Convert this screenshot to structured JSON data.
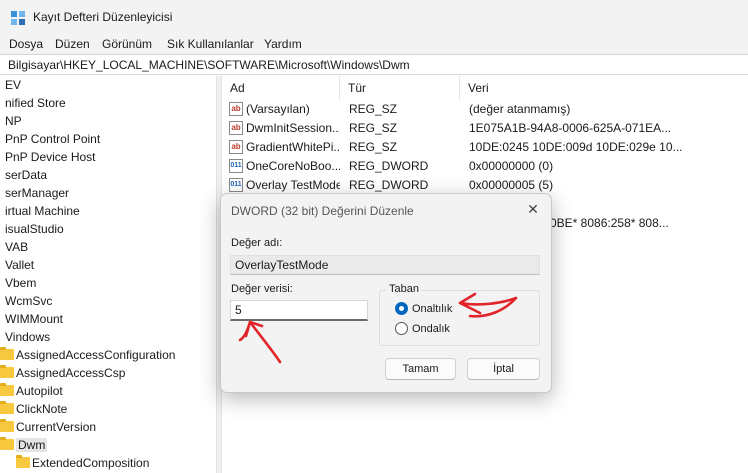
{
  "window": {
    "title": "Kayıt Defteri Düzenleyicisi"
  },
  "menu": [
    "Dosya",
    "Düzen",
    "Görünüm",
    "Sık Kullanılanlar",
    "Yardım"
  ],
  "address": "Bilgisayar\\HKEY_LOCAL_MACHINE\\SOFTWARE\\Microsoft\\Windows\\Dwm",
  "tree": {
    "items": [
      "EV",
      "nified Store",
      "NP",
      "PnP Control Point",
      "PnP Device Host",
      "serData",
      "serManager",
      "irtual Machine",
      "isualStudio",
      "VAB",
      "Vallet",
      "Vbem",
      "WcmSvc",
      "WIMMount",
      "Vindows"
    ],
    "subitems": [
      "AssignedAccessConfiguration",
      "AssignedAccessCsp",
      "Autopilot",
      "ClickNote",
      "CurrentVersion",
      "Dwm",
      "ExtendedComposition"
    ],
    "selected": "Dwm"
  },
  "list": {
    "columns": [
      "Ad",
      "Tür",
      "Veri"
    ],
    "rows": [
      {
        "icon": "string-value-icon",
        "name": "(Varsayılan)",
        "type": "REG_SZ",
        "data": "(değer atanmamış)"
      },
      {
        "icon": "string-value-icon",
        "name": "DwmInitSession...",
        "type": "REG_SZ",
        "data": "1E075A1B-94A8-0006-625A-071EA..."
      },
      {
        "icon": "string-value-icon",
        "name": "GradientWhitePi...",
        "type": "REG_SZ",
        "data": "10DE:0245 10DE:009d 10DE:029e 10..."
      },
      {
        "icon": "dword-value-icon",
        "name": "OneCoreNoBoo...",
        "type": "REG_DWORD",
        "data": "0x00000000 (0)"
      },
      {
        "icon": "dword-value-icon",
        "name": "Overlay TestMode",
        "type": "REG_DWORD",
        "data": "0x00000005 (5)"
      }
    ],
    "partial_data": "0BE* 8086:258* 808..."
  },
  "dialog": {
    "title": "DWORD (32 bit) Değerini Düzenle",
    "name_label": "Değer adı:",
    "name_value": "OverlayTestMode",
    "value_label": "Değer verisi:",
    "value_value": "5",
    "base_label": "Taban",
    "radio_hex": "Onaltılık",
    "radio_dec": "Ondalık",
    "ok": "Tamam",
    "cancel": "İptal",
    "selected_base": "hex"
  },
  "colors": {
    "accent": "#0067c0",
    "annotation": "#e0242a"
  }
}
